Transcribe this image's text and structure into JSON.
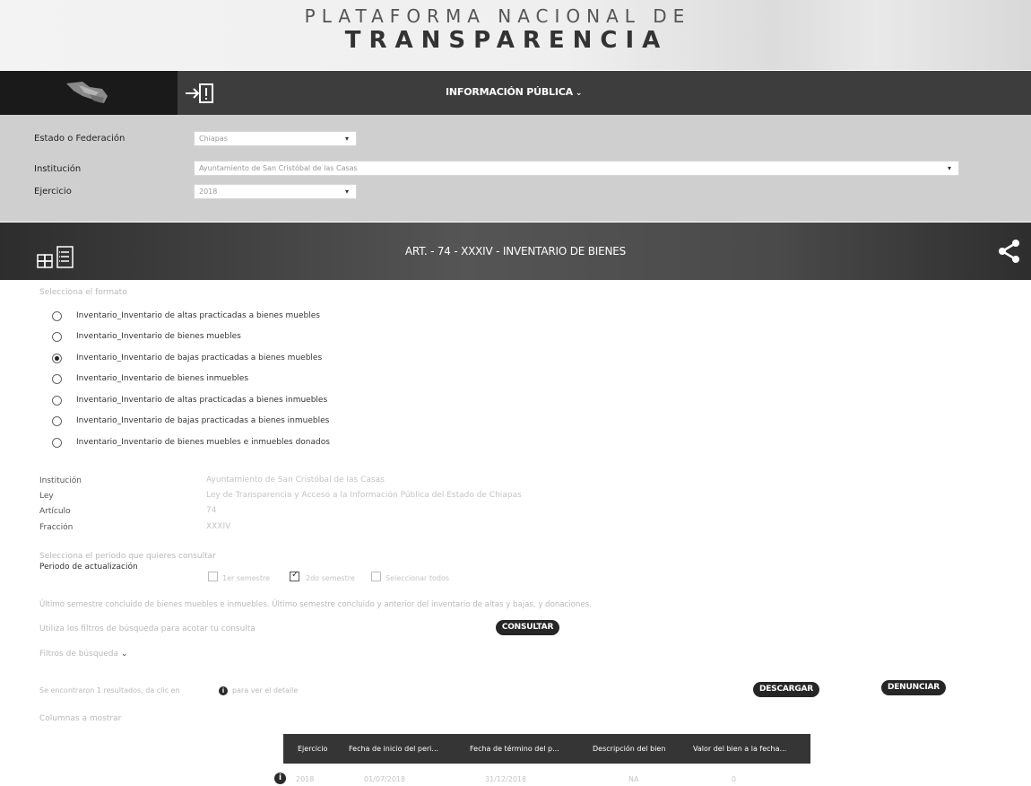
{
  "header": {
    "title_line1": "PLATAFORMA NACIONAL DE",
    "title_line2": "TRANSPARENCIA"
  },
  "nav": {
    "info_label": "INFORMACIÓN PÚBLICA",
    "info_chevron": "⌄"
  },
  "filters": {
    "estado_label": "Estado o Federación",
    "estado_value": "Chiapas",
    "institucion_label": "Institución",
    "institucion_value": "Ayuntamiento de San Cristóbal de las Casas",
    "ejercicio_label": "Ejercicio",
    "ejercicio_value": "2018"
  },
  "article": {
    "title": "ART. - 74 - XXXIV - INVENTARIO DE BIENES"
  },
  "formats": {
    "prompt": "Selecciona el formato",
    "options": [
      {
        "label": "Inventario_Inventario de altas practicadas a bienes muebles",
        "selected": false
      },
      {
        "label": "Inventario_Inventario de bienes muebles",
        "selected": false
      },
      {
        "label": "Inventario_Inventario de bajas practicadas a bienes muebles",
        "selected": true
      },
      {
        "label": "Inventario_Inventario de bienes inmuebles",
        "selected": false
      },
      {
        "label": "Inventario_Inventario de altas practicadas a bienes inmuebles",
        "selected": false
      },
      {
        "label": "Inventario_Inventario de bajas practicadas a bienes inmuebles",
        "selected": false
      },
      {
        "label": "Inventario_Inventario de bienes muebles e inmuebles donados",
        "selected": false
      }
    ]
  },
  "info": {
    "institucion_label": "Institución",
    "institucion_value": "Ayuntamiento de San Cristóbal de las Casas",
    "ley_label": "Ley",
    "ley_value": "Ley de Transparencia y Acceso a la Información Pública del Estado de Chiapas",
    "articulo_label": "Artículo",
    "articulo_value": "74",
    "fraccion_label": "Fracción",
    "fraccion_value": "XXXIV"
  },
  "period": {
    "prompt": "Selecciona el periodo que quieres consultar",
    "label": "Periodo de actualización",
    "options": [
      {
        "label": "1er semestre",
        "checked": false
      },
      {
        "label": "2do semestre",
        "checked": true
      },
      {
        "label": "Seleccionar todos",
        "checked": false
      }
    ]
  },
  "notes": {
    "description": "Último semestre concluido de bienes muebles e inmuebles. Último semestre concluido y anterior del inventario de altas y bajas, y donaciones.",
    "filter_hint": "Utiliza los filtros de búsqueda para acotar tu consulta",
    "consultar_label": "CONSULTAR",
    "filters_label": "Filtros de búsqueda",
    "filters_chevron": "⌄",
    "results_text": "Se encontraron 1 resultados, da clic en",
    "results_suffix": "para ver el detalle",
    "descargar_label": "DESCARGAR",
    "denunciar_label": "DENUNCIAR",
    "columns_label": "Columnas a mostrar"
  },
  "table": {
    "headers": [
      "Ejercicio",
      "Fecha de inicio del peri...",
      "Fecha de término del p...",
      "Descripción del bien",
      "Valor del bien a la fecha..."
    ],
    "rows": [
      [
        "2018",
        "01/07/2018",
        "31/12/2018",
        "NA",
        "0"
      ]
    ]
  },
  "icons": {
    "row_info": "i",
    "results_info": "i"
  }
}
